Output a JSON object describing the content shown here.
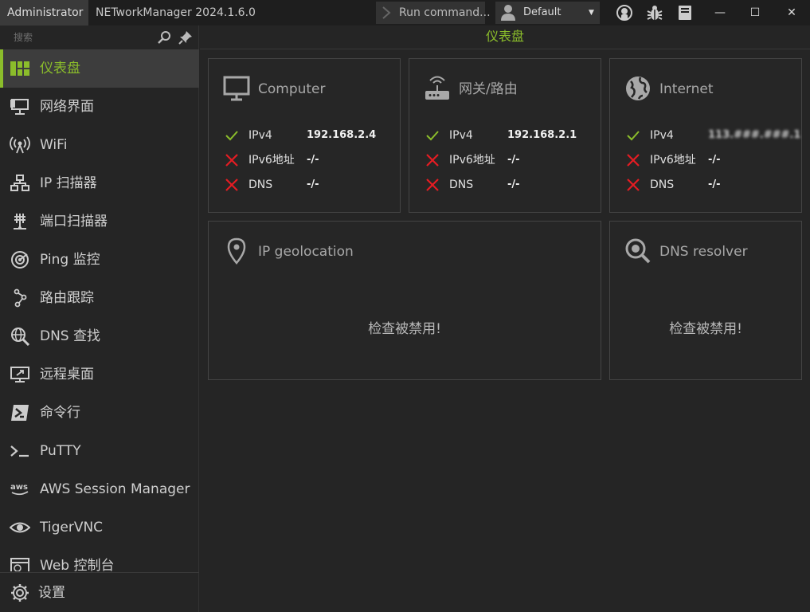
{
  "titlebar": {
    "admin": "Administrator",
    "title": "NETworkManager 2024.1.6.0",
    "run_command": "Run command...",
    "profile": "Default",
    "icons": [
      "github-icon",
      "bug-icon",
      "docs-icon"
    ],
    "minimize": "—",
    "maximize": "☐",
    "close": "✕"
  },
  "search": {
    "placeholder": "搜索"
  },
  "nav": {
    "items": [
      {
        "label": "仪表盘",
        "icon": "dashboard-icon",
        "active": true
      },
      {
        "label": "网络界面",
        "icon": "network-interface-icon"
      },
      {
        "label": "WiFi",
        "icon": "wifi-icon"
      },
      {
        "label": "IP 扫描器",
        "icon": "ip-scanner-icon"
      },
      {
        "label": "端口扫描器",
        "icon": "port-scanner-icon"
      },
      {
        "label": "Ping 监控",
        "icon": "ping-monitor-icon"
      },
      {
        "label": "路由跟踪",
        "icon": "traceroute-icon"
      },
      {
        "label": "DNS 查找",
        "icon": "dns-lookup-icon"
      },
      {
        "label": "远程桌面",
        "icon": "remote-desktop-icon"
      },
      {
        "label": "命令行",
        "icon": "powershell-icon"
      },
      {
        "label": "PuTTY",
        "icon": "terminal-icon"
      },
      {
        "label": "AWS Session Manager",
        "icon": "aws-icon"
      },
      {
        "label": "TigerVNC",
        "icon": "eye-icon"
      },
      {
        "label": "Web 控制台",
        "icon": "web-console-icon"
      }
    ],
    "settings": "设置"
  },
  "main": {
    "title": "仪表盘",
    "cards": {
      "computer": {
        "title": "Computer",
        "rows": [
          {
            "key": "IPv4",
            "value": "192.168.2.4",
            "ok": true
          },
          {
            "key": "IPv6地址",
            "value": "-/-",
            "ok": false
          },
          {
            "key": "DNS",
            "value": "-/-",
            "ok": false
          }
        ]
      },
      "gateway": {
        "title": "网关/路由",
        "rows": [
          {
            "key": "IPv4",
            "value": "192.168.2.1",
            "ok": true
          },
          {
            "key": "IPv6地址",
            "value": "-/-",
            "ok": false
          },
          {
            "key": "DNS",
            "value": "-/-",
            "ok": false
          }
        ]
      },
      "internet": {
        "title": "Internet",
        "rows": [
          {
            "key": "IPv4",
            "value": "113.###.###.1",
            "ok": true
          },
          {
            "key": "IPv6地址",
            "value": "-/-",
            "ok": false
          },
          {
            "key": "DNS",
            "value": "-/-",
            "ok": false
          }
        ]
      },
      "geolocation": {
        "title": "IP geolocation",
        "message": "检查被禁用!"
      },
      "dns_resolver": {
        "title": "DNS resolver",
        "message": "检查被禁用!"
      }
    }
  },
  "colors": {
    "accent": "#8bbd2b",
    "ok": "#8bbd2b",
    "fail": "#e51c23",
    "background": "#252525"
  }
}
